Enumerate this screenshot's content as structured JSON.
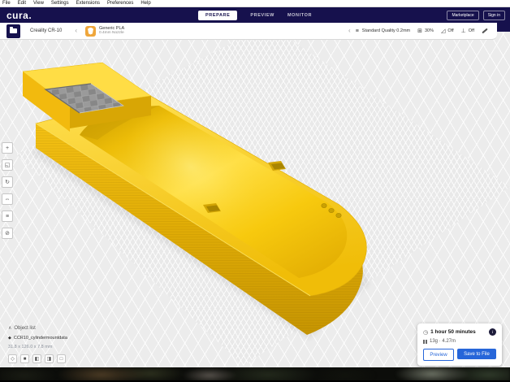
{
  "menu": {
    "items": [
      "File",
      "Edit",
      "View",
      "Settings",
      "Extensions",
      "Preferences",
      "Help"
    ]
  },
  "header": {
    "logo": "cura.",
    "tabs": [
      {
        "label": "PREPARE",
        "active": true
      },
      {
        "label": "PREVIEW",
        "active": false
      },
      {
        "label": "MONITOR",
        "active": false
      }
    ],
    "marketplace_label": "Marketplace",
    "sign_in_label": "Sign in"
  },
  "config_bar": {
    "printer_name": "Creality CR-10",
    "material_name": "Generic PLA",
    "nozzle": "0.4mm Nozzle",
    "profile": "Standard Quality 0.2mm",
    "infill_value": "30%",
    "support_value": "Off",
    "adhesion_value": "Off"
  },
  "object_list": {
    "title": "Object list",
    "model_name": "CCR10_cylindermountdata",
    "dimensions": "31.8 x 126.0 x 7.8 mm"
  },
  "print_estimate": {
    "time": "1 hour 50 minutes",
    "material_usage": "13g · 4.27m",
    "preview_label": "Preview",
    "save_label": "Save to File"
  },
  "icons": {
    "chevron_left": "‹",
    "profile": "≡",
    "infill": "⊞",
    "support": "◿",
    "adhesion": "⊥",
    "clock": "◷",
    "info": "i",
    "caret_up": "∧",
    "model_cube": "◆",
    "tool_move": "+",
    "tool_scale": "◱",
    "tool_rotate": "↻",
    "tool_mirror": "⇔",
    "tool_per_model": "≡",
    "tool_support_blocker": "⊘",
    "view_3d": "◇",
    "view_front": "■",
    "view_left": "◧",
    "view_right": "◨",
    "view_top": "□"
  },
  "colors": {
    "header_navy": "#16114d",
    "accent_blue": "#2766d9",
    "model_yellow": "#f7c70e",
    "material_icon_orange": "#efa63b",
    "viewport_gray": "#ececec"
  }
}
